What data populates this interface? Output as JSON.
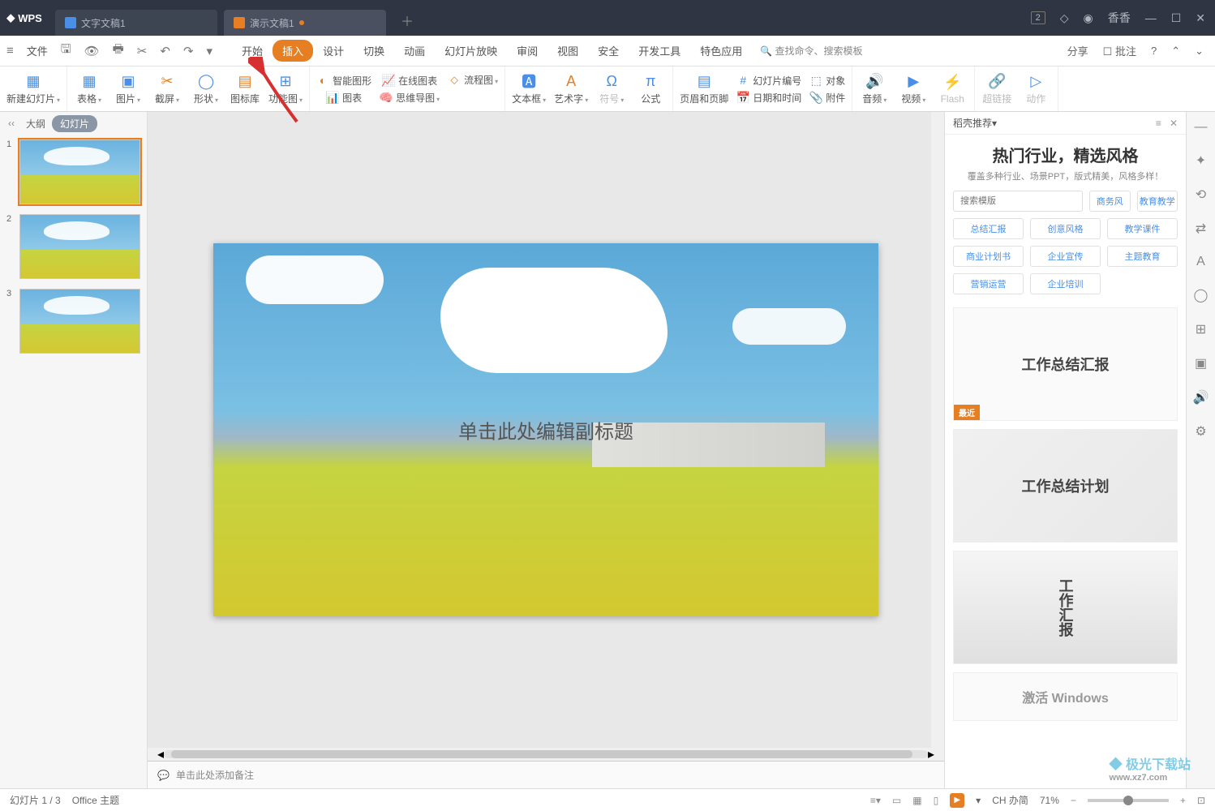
{
  "titlebar": {
    "brand": "WPS",
    "tabs": [
      {
        "icon": "w",
        "label": "文字文稿1",
        "active": false,
        "modified": false
      },
      {
        "icon": "p",
        "label": "演示文稿1",
        "active": true,
        "modified": true
      }
    ],
    "badge": "2",
    "user": "香香"
  },
  "menu": {
    "file": "文件",
    "tabs": [
      "开始",
      "插入",
      "设计",
      "切换",
      "动画",
      "幻灯片放映",
      "审阅",
      "视图",
      "安全",
      "开发工具",
      "特色应用"
    ],
    "active_tab": "插入",
    "search": "查找命令、搜索模板",
    "share": "分享",
    "annotate": "批注"
  },
  "ribbon": {
    "new_slide": "新建幻灯片",
    "table": "表格",
    "picture": "图片",
    "screenshot": "截屏",
    "shape": "形状",
    "icon_lib": "图标库",
    "func_chart": "功能图",
    "smart_graphic": "智能图形",
    "online_chart": "在线图表",
    "flow_chart": "流程图",
    "mind_map": "思维导图",
    "chart": "图表",
    "textbox": "文本框",
    "wordart": "艺术字",
    "symbol": "符号",
    "equation": "公式",
    "header_footer": "页眉和页脚",
    "slide_number": "幻灯片编号",
    "date_time": "日期和时间",
    "object": "对象",
    "attachment": "附件",
    "audio": "音频",
    "video": "视频",
    "flash": "Flash",
    "hyperlink": "超链接",
    "action": "动作"
  },
  "left": {
    "outline": "大纲",
    "slides": "幻灯片",
    "count": 3,
    "selected": 1
  },
  "slide": {
    "subtitle_placeholder": "单击此处编辑副标题"
  },
  "notes": {
    "placeholder": "单击此处添加备注"
  },
  "right": {
    "panel_title": "稻壳推荐",
    "heading": "热门行业，精选风格",
    "sub": "覆盖多种行业、场景PPT，版式精美，风格多样！",
    "search_placeholder": "搜索模版",
    "tags_top": [
      "商务风",
      "教育教学"
    ],
    "tags": [
      "总结汇报",
      "创意风格",
      "教学课件",
      "商业计划书",
      "企业宣传",
      "主题教育",
      "营销运营",
      "企业培训"
    ],
    "cards": [
      {
        "title": "工作总结汇报",
        "badge": "最近"
      },
      {
        "title": "工作总结计划"
      },
      {
        "title": "工作汇报"
      }
    ],
    "activate": "激活 Windows"
  },
  "status": {
    "slide_indicator": "幻灯片 1 / 3",
    "theme": "Office 主题",
    "ime": "CH 办简",
    "zoom": "71%"
  },
  "watermark": "极光下载站",
  "watermark_url": "www.xz7.com"
}
